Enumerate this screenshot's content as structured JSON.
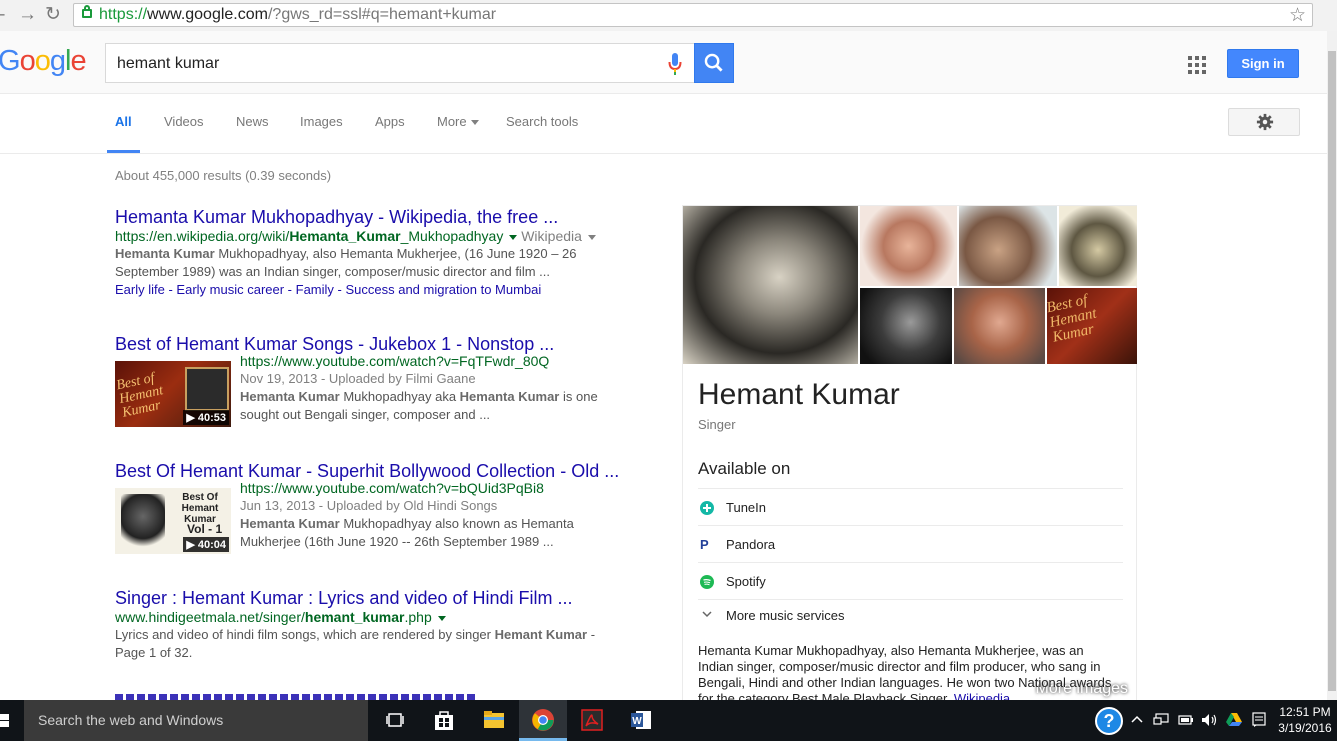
{
  "browser": {
    "url_scheme": "https://",
    "url_host": "www.google.com",
    "url_rest": "/?gws_rd=ssl#q=hemant+kumar"
  },
  "google": {
    "logo": [
      "G",
      "o",
      "o",
      "g",
      "l",
      "e"
    ],
    "query": "hemant kumar",
    "signin_label": "Sign in"
  },
  "tabs": [
    {
      "label": "All",
      "active": true
    },
    {
      "label": "Videos"
    },
    {
      "label": "News"
    },
    {
      "label": "Images"
    },
    {
      "label": "Apps"
    },
    {
      "label": "More"
    },
    {
      "label": "Search tools"
    }
  ],
  "stats": "About 455,000 results (0.39 seconds)",
  "results": [
    {
      "title": "Hemanta Kumar Mukhopadhyay - Wikipedia, the free ...",
      "url_a": "https://en.wikipedia.org/wiki/",
      "url_b": "Hemanta_Kumar",
      "url_c": "_Mukhopadhyay",
      "source": "Wikipedia",
      "snippet_b1": "Hemanta Kumar",
      "snippet_1": " Mukhopadhyay, also Hemanta Mukherjee, (16 June 1920 – 26",
      "snippet_2": "September 1989) was an Indian singer, composer/music director and film ...",
      "sitelinks": [
        "Early life",
        "Early music career",
        "Family",
        "Success and migration to Mumbai"
      ]
    },
    {
      "title": "Best of Hemant Kumar Songs - Jukebox 1 - Nonstop ...",
      "url": "https://www.youtube.com/watch?v=FqTFwdr_80Q",
      "date": "Nov 19, 2013 - Uploaded by Filmi Gaane",
      "snippet_b1": "Hemanta Kumar",
      "snippet_1": " Mukhopadhyay aka ",
      "snippet_b2": "Hemanta Kumar",
      "snippet_2": " is one",
      "snippet_3": "sought out Bengali singer, composer and ...",
      "duration": "▶ 40:53",
      "thumb_text": "Best of Hemant Kumar"
    },
    {
      "title": "Best Of Hemant Kumar - Superhit Bollywood Collection - Old ...",
      "url": "https://www.youtube.com/watch?v=bQUid3PqBi8",
      "date": "Jun 13, 2013 - Uploaded by Old Hindi Songs",
      "snippet_b1": "Hemanta Kumar",
      "snippet_1": " Mukhopadhyay also known as Hemanta",
      "snippet_2": "Mukherjee (16th June 1920 -- 26th September 1989 ...",
      "duration": "▶ 40:04",
      "thumb_text": "Best Of Hemant Kumar",
      "thumb_vol": "Vol - 1"
    },
    {
      "title": "Singer : Hemant Kumar : Lyrics and video of Hindi Film ...",
      "url_a": "www.hindigeetmala.net/singer/",
      "url_b": "hemant_kumar",
      "url_c": ".php",
      "snippet_1": "Lyrics and video of hindi film songs, which are rendered by singer ",
      "snippet_b1": "Hemant Kumar",
      "snippet_2": " -",
      "snippet_3": "Page 1 of 32."
    }
  ],
  "knowledge_panel": {
    "more_images": "More images",
    "title": "Hemant Kumar",
    "subtitle": "Singer",
    "available_on": "Available on",
    "services": [
      {
        "label": "TuneIn",
        "icon": "tunein-icon",
        "color": "#14b8a6"
      },
      {
        "label": "Pandora",
        "icon": "pandora-icon",
        "color": "#224099"
      },
      {
        "label": "Spotify",
        "icon": "spotify-icon",
        "color": "#1db954"
      }
    ],
    "more_services": "More music services",
    "description": "Hemanta Kumar Mukhopadhyay, also Hemanta Mukherjee, was an Indian singer, composer/music director and film producer, who sang in Bengali, Hindi and other Indian languages. He won two National awards for the category Best Male Playback Singer. ",
    "description_link": "Wikipedia",
    "thumb_badge": "Best of Hemant Kumar"
  },
  "taskbar": {
    "search_placeholder": "Search the web and Windows",
    "time": "12:51 PM",
    "date": "3/19/2016"
  }
}
